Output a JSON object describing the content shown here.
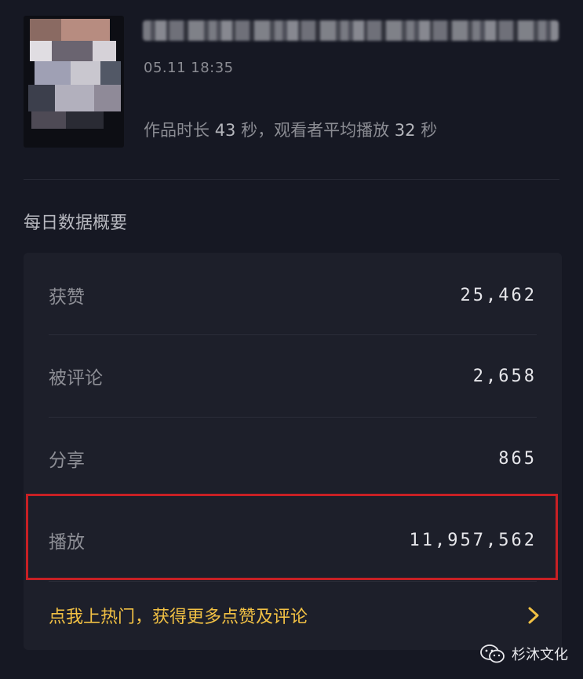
{
  "video": {
    "title": "",
    "date": "05.11 18:35",
    "duration_prefix": "作品时长",
    "duration_value": "43",
    "duration_unit": "秒，观看者平均播放",
    "avg_play_value": "32",
    "avg_play_unit": "秒"
  },
  "summary": {
    "title": "每日数据概要",
    "stats": [
      {
        "label": "获赞",
        "value": "25,462"
      },
      {
        "label": "被评论",
        "value": "2,658"
      },
      {
        "label": "分享",
        "value": "865"
      },
      {
        "label": "播放",
        "value": "11,957,562"
      }
    ],
    "highlighted_index": 3,
    "highlight_color": "#c82024"
  },
  "promo": {
    "text": "点我上热门，获得更多点赞及评论",
    "icon": "chevron-right-icon",
    "color": "#f2c144"
  },
  "watermark": {
    "icon": "wechat-icon",
    "text": "杉沐文化"
  }
}
